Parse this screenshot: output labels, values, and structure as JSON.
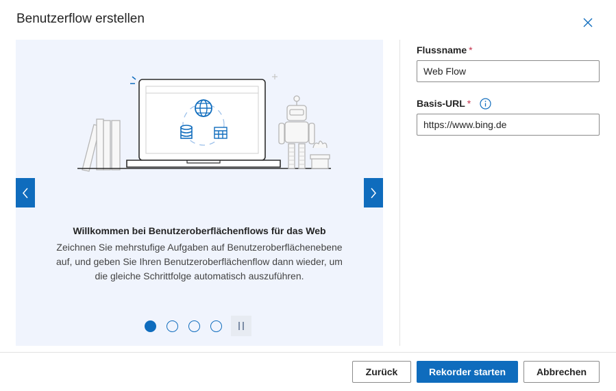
{
  "dialog": {
    "title": "Benutzerflow erstellen",
    "close_icon": "close-icon"
  },
  "carousel": {
    "slide_title": "Willkommen bei Benutzeroberflächenflows für das Web",
    "slide_description": "Zeichnen Sie mehrstufige Aufgaben auf Benutzeroberflächenebene auf, und geben Sie Ihren Benutzeroberflächenflow dann wieder, um die gleiche Schrittfolge automatisch auszuführen.",
    "prev_icon": "chevron-left-icon",
    "next_icon": "chevron-right-icon",
    "pause_icon": "pause-icon",
    "slide_count": 4,
    "active_slide": 1
  },
  "form": {
    "flow_name": {
      "label": "Flussname",
      "required_marker": "*",
      "value": "Web Flow"
    },
    "base_url": {
      "label": "Basis-URL",
      "required_marker": "*",
      "info_icon": "info-icon",
      "value": "https://www.bing.de"
    }
  },
  "footer": {
    "back_label": "Zurück",
    "start_label": "Rekorder starten",
    "cancel_label": "Abbrechen"
  },
  "colors": {
    "accent": "#0f6cbd",
    "carousel_background": "#f0f4fd",
    "required": "#c4314b"
  }
}
